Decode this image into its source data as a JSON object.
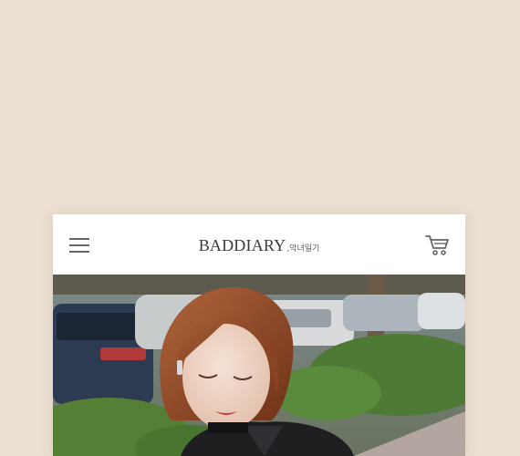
{
  "header": {
    "logo_main": "BADDIARY",
    "logo_sub": ",악녀일기",
    "menu_icon": "hamburger-menu-icon",
    "cart_icon": "shopping-cart-icon"
  },
  "colors": {
    "page_background": "#ece0d3",
    "header_background": "#ffffff",
    "icon_color": "#666666"
  }
}
